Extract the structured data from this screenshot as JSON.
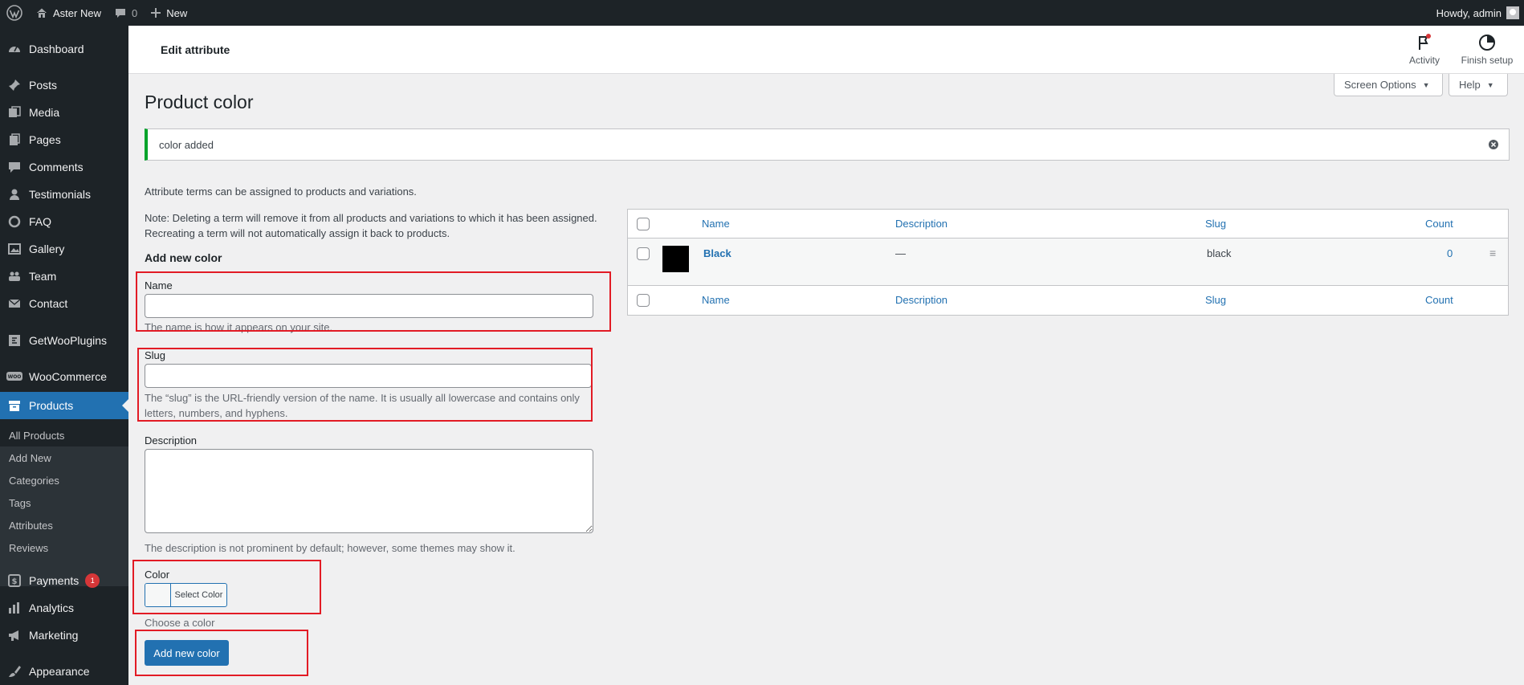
{
  "admin_bar": {
    "site_name": "Aster New",
    "comments_count": "0",
    "new_label": "New",
    "howdy": "Howdy, admin"
  },
  "sidebar": {
    "items": [
      {
        "label": "Dashboard",
        "icon": "dashboard-icon"
      },
      {
        "label": "Posts",
        "icon": "pin-icon"
      },
      {
        "label": "Media",
        "icon": "media-icon"
      },
      {
        "label": "Pages",
        "icon": "pages-icon"
      },
      {
        "label": "Comments",
        "icon": "comment-icon"
      },
      {
        "label": "Testimonials",
        "icon": "person-icon"
      },
      {
        "label": "FAQ",
        "icon": "circle-icon"
      },
      {
        "label": "Gallery",
        "icon": "gallery-icon"
      },
      {
        "label": "Team",
        "icon": "team-icon"
      },
      {
        "label": "Contact",
        "icon": "mail-icon"
      },
      {
        "label": "GetWooPlugins",
        "icon": "plugin-icon"
      },
      {
        "label": "WooCommerce",
        "icon": "woo-icon"
      },
      {
        "label": "Products",
        "icon": "archive-icon"
      },
      {
        "label": "Payments",
        "icon": "dollar-icon",
        "badge": "1"
      },
      {
        "label": "Analytics",
        "icon": "bar-chart-icon"
      },
      {
        "label": "Marketing",
        "icon": "megaphone-icon"
      },
      {
        "label": "Appearance",
        "icon": "brush-icon"
      }
    ],
    "submenu": [
      "All Products",
      "Add New",
      "Categories",
      "Tags",
      "Attributes",
      "Reviews"
    ]
  },
  "wc_header": {
    "title": "Edit attribute",
    "activity": "Activity",
    "finish_setup": "Finish setup"
  },
  "screen_options": "Screen Options",
  "help": "Help",
  "page_title": "Product color",
  "notice": "color added",
  "intro": "Attribute terms can be assigned to products and variations.",
  "note_line1": "Note: Deleting a term will remove it from all products and variations to which it has been assigned.",
  "note_line2": "Recreating a term will not automatically assign it back to products.",
  "form": {
    "heading": "Add new color",
    "name_label": "Name",
    "name_value": "",
    "name_desc": "The name is how it appears on your site.",
    "slug_label": "Slug",
    "slug_value": "",
    "slug_desc_line1": "The “slug” is the URL-friendly version of the name. It is usually all lowercase and contains only",
    "slug_desc_line2": "letters, numbers, and hyphens.",
    "description_label": "Description",
    "description_value": "",
    "description_desc": "The description is not prominent by default; however, some themes may show it.",
    "color_label": "Color",
    "select_color": "Select Color",
    "choose_color": "Choose a color",
    "submit": "Add new color"
  },
  "table": {
    "columns": {
      "name": "Name",
      "description": "Description",
      "slug": "Slug",
      "count": "Count"
    },
    "rows": [
      {
        "name": "Black",
        "description": "—",
        "slug": "black",
        "count": "0",
        "swatch": "#000000"
      }
    ]
  },
  "colors": {
    "accent": "#2271b1",
    "admin_bg": "#1d2327",
    "success": "#00a32a",
    "highlight": "#e21b25"
  }
}
